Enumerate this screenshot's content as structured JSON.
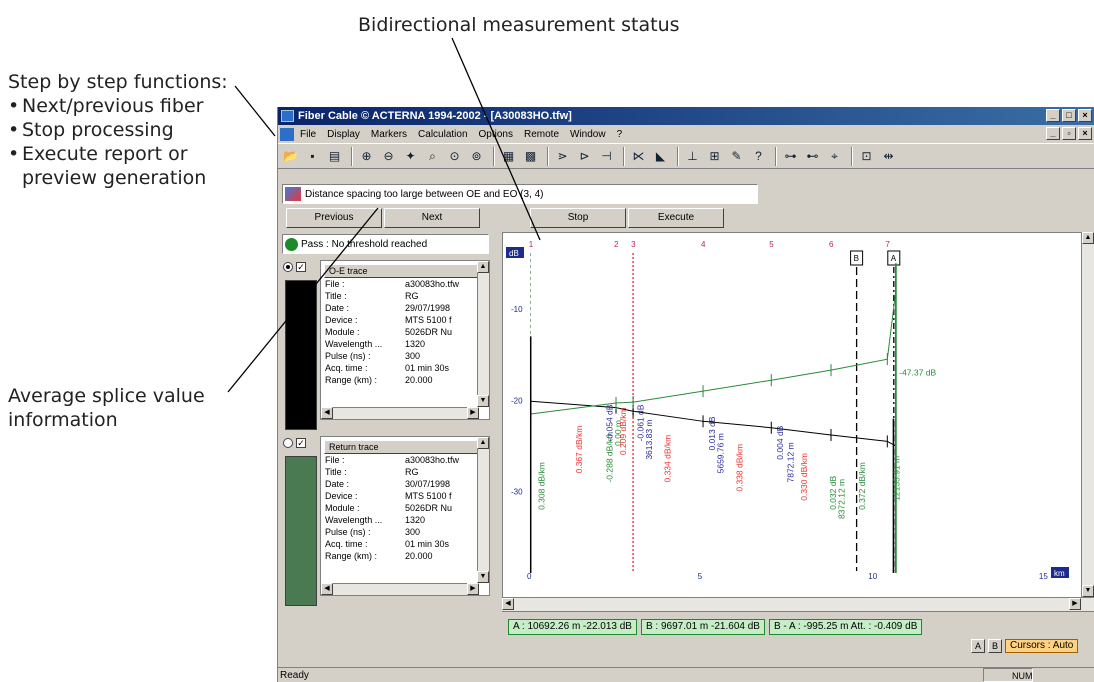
{
  "callouts": {
    "bidirectional": "Bidirectional measurement status",
    "step_title": "Step by step functions:",
    "step_items": [
      "Next/previous fiber",
      "Stop processing",
      "Execute report or",
      "preview generation"
    ],
    "splice_line1": "Average splice value",
    "splice_line2": "information"
  },
  "window": {
    "title": "Fiber Cable © ACTERNA 1994-2002 - [A30083HO.tfw]",
    "title_visible": "Fiber Cable © ACTERNA 1994-2002 - [A30083HO.tfw]"
  },
  "menu": [
    "File",
    "Display",
    "Markers",
    "Calculation",
    "Options",
    "Remote",
    "Window",
    "?"
  ],
  "toolbar_icons": [
    "open-icon",
    "save-icon",
    "print-icon",
    "zoom-in-icon",
    "zoom-out-icon",
    "zoom-fit-icon",
    "zoom-region-icon",
    "zoom-x-icon",
    "zoom-y-icon",
    "table-icon",
    "measure-icon",
    "splice-icon",
    "trace-icon",
    "marker-icon",
    "event-icon",
    "cursor-icon",
    "section-icon",
    "edit-icon",
    "report-icon",
    "help-icon"
  ],
  "status_message": "Distance spacing too large between OE and EO (3, 4)",
  "buttons": {
    "previous": "Previous",
    "next": "Next",
    "stop": "Stop",
    "execute": "Execute"
  },
  "result": "Pass : No threshold reached",
  "trace1": {
    "name": "O-E trace",
    "rows": [
      {
        "k": "File :",
        "v": "a30083ho.tfw"
      },
      {
        "k": "Title :",
        "v": "RG"
      },
      {
        "k": "Date :",
        "v": "29/07/1998"
      },
      {
        "k": "Device :",
        "v": "MTS 5100 f"
      },
      {
        "k": "Module :",
        "v": "5026DR Nu"
      },
      {
        "k": "Wavelength ...",
        "v": "1320"
      },
      {
        "k": "Pulse (ns) :",
        "v": "300"
      },
      {
        "k": "Acq. time :",
        "v": "01 min 30s"
      },
      {
        "k": "Range (km) :",
        "v": "20.000"
      }
    ],
    "color": "#000000"
  },
  "trace2": {
    "name": "Return trace",
    "rows": [
      {
        "k": "File :",
        "v": "a30083ho.tfw"
      },
      {
        "k": "Title :",
        "v": "RG"
      },
      {
        "k": "Date :",
        "v": "30/07/1998"
      },
      {
        "k": "Device :",
        "v": "MTS 5100 f"
      },
      {
        "k": "Module :",
        "v": "5026DR Nu"
      },
      {
        "k": "Wavelength ...",
        "v": "1320"
      },
      {
        "k": "Pulse (ns) :",
        "v": "300"
      },
      {
        "k": "Acq. time :",
        "v": "01 min 30s"
      },
      {
        "k": "Range (km) :",
        "v": "20.000"
      }
    ],
    "color": "#4a7a52"
  },
  "chart_data": {
    "type": "line",
    "ylabel": "dB",
    "xlabel": "km",
    "y_ticks": [
      -10,
      -20,
      -30
    ],
    "x_ticks": [
      0,
      5,
      10,
      15
    ],
    "xlim": [
      0,
      16
    ],
    "ylim": [
      -40,
      -3
    ],
    "event_numbers": [
      "1",
      "2",
      "3",
      "4",
      "5",
      "6",
      "7"
    ],
    "event_x": [
      0.05,
      2.55,
      3.05,
      5.1,
      7.1,
      8.85,
      10.5
    ],
    "markers": [
      {
        "label": "B",
        "x": 9.6
      },
      {
        "label": "A",
        "x": 10.69
      }
    ],
    "series": [
      {
        "name": "O-E trace",
        "x": [
          0.05,
          2.55,
          3.05,
          5.1,
          7.1,
          8.85,
          10.5,
          10.75
        ],
        "y": [
          -20.1,
          -20.8,
          -21.2,
          -22.3,
          -23.0,
          -23.8,
          -24.5,
          -25.0
        ],
        "color": "#000000"
      },
      {
        "name": "Return trace",
        "x": [
          0.05,
          2.55,
          3.05,
          5.1,
          7.1,
          8.85,
          10.5,
          10.75
        ],
        "y": [
          -21.5,
          -20.3,
          -20.2,
          -19.0,
          -17.8,
          -16.7,
          -15.5,
          -8.0
        ],
        "color": "#2a8a3a"
      }
    ],
    "labels_green": [
      "0.308 dB/km",
      "-0.288 dB/km",
      "0.00 m",
      "0.032 dB",
      "8372.12 m",
      "0.372 dB/km",
      "12135.91 m",
      "-47.37 dB"
    ],
    "labels_red": [
      "0.367 dB/km",
      "0.209 dB/km",
      "0.334 dB/km",
      "0.338 dB/km",
      "0.330 dB/km"
    ],
    "labels_blue": [
      "-0.054 dB",
      "-0.061 dB",
      "3613.83 m",
      "0.013 dB",
      "5659.76 m",
      "0.004 dB",
      "7872.12 m"
    ]
  },
  "cursors": {
    "a": "A : 10692.26 m  -22.013 dB",
    "b": "B : 9697.01 m  -21.604 dB",
    "ba": "B - A : -995.25 m  Att. : -0.409 dB",
    "a_btn": "A",
    "b_btn": "B",
    "mode": "Cursors : Auto"
  },
  "statusbar": {
    "text": "Ready",
    "num": "NUM"
  }
}
